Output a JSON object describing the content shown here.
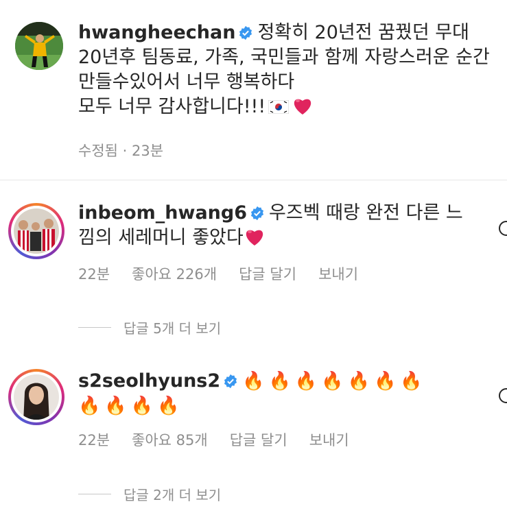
{
  "caption": {
    "username": "hwangheechan",
    "lines": [
      "정확히 20년전 꿈꿨던 무대",
      "20년후 팀동료, 가족, 국민들과 함께 자랑스러운 순간",
      "만들수있어서 너무 행복하다",
      "모두 너무 감사합니다!!!"
    ],
    "meta": "수정됨 · 23분"
  },
  "comments": [
    {
      "username": "inbeom_hwang6",
      "line1": "우즈벡 때랑 완전 다른 느",
      "line2": "낌의 세레머니 좋았다",
      "time": "22분",
      "likes": "좋아요 226개",
      "reply": "답글 달기",
      "send": "보내기",
      "view_replies": "답글 5개 더 보기"
    },
    {
      "username": "s2seolhyuns2",
      "line1": "🔥🔥🔥🔥🔥🔥🔥",
      "line2": "🔥🔥🔥🔥",
      "time": "22분",
      "likes": "좋아요 85개",
      "reply": "답글 달기",
      "send": "보내기",
      "view_replies": "답글 2개 더 보기"
    }
  ],
  "colors": {
    "verified": "#3897f0",
    "heart": "#e0245e",
    "meta": "#8e8e8e"
  }
}
